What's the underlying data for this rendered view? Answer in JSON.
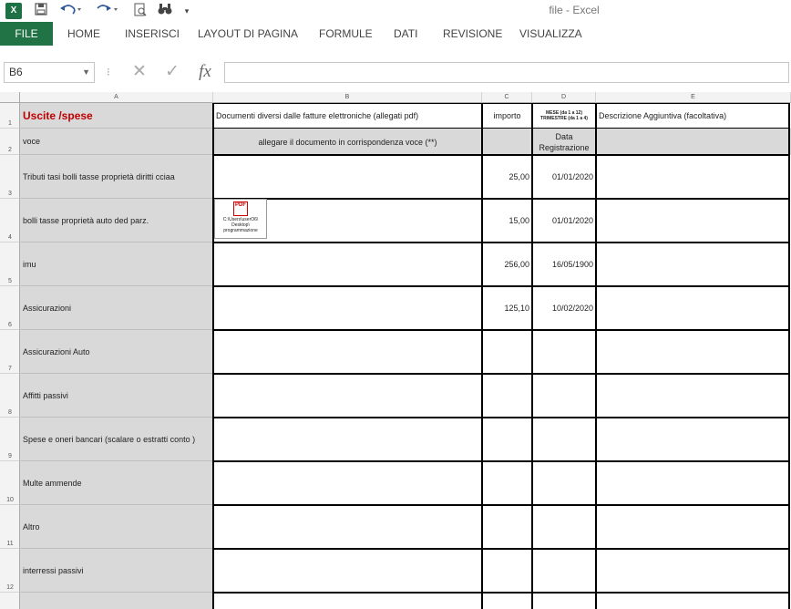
{
  "app": {
    "window_title": "file - Excel",
    "logo": "X",
    "qat": {
      "save_icon": "save-icon",
      "undo_icon": "undo-icon",
      "redo_icon": "redo-icon",
      "preview_icon": "print-preview-icon",
      "find_icon": "binoculars-icon"
    }
  },
  "ribbon": {
    "file_tab": "FILE",
    "tabs": [
      "HOME",
      "INSERISCI",
      "LAYOUT DI PAGINA",
      "FORMULE",
      "DATI",
      "REVISIONE",
      "VISUALIZZA"
    ]
  },
  "formula_bar": {
    "name_box": "B6",
    "cancel_glyph": "✕",
    "enter_glyph": "✓",
    "fx_glyph": "fx",
    "content": ""
  },
  "sheet": {
    "columns": [
      "A",
      "B",
      "C",
      "D",
      "E"
    ],
    "rows": [
      "1",
      "2",
      "3",
      "4",
      "5",
      "6",
      "7",
      "8",
      "9",
      "10",
      "11",
      "12"
    ],
    "header": {
      "a1": "Uscite /spese",
      "b1": "Documenti diversi dalle fatture elettroniche (allegati pdf)",
      "c1": "importo",
      "d1": "MESE (da 1 a 12) TRIMESTRE (da 1 a 4)",
      "e1": "Descrizione Aggiuntiva (facoltativa)",
      "a2": "voce",
      "b2": "allegare il documento in corrispondenza voce (**)",
      "d2": "Data Registrazione"
    },
    "items": [
      {
        "voce": "Tributi tasi bolli tasse proprietà diritti cciaa",
        "importo": "25,00",
        "data": "01/01/2020"
      },
      {
        "voce": "bolli tasse proprietà auto ded parz.",
        "importo": "15,00",
        "data": "01/01/2020"
      },
      {
        "voce": "imu",
        "importo": "256,00",
        "data": "16/05/1900"
      },
      {
        "voce": "Assicurazioni",
        "importo": "125,10",
        "data": "10/02/2020"
      },
      {
        "voce": "Assicurazioni Auto",
        "importo": "",
        "data": ""
      },
      {
        "voce": "Affitti passivi",
        "importo": "",
        "data": ""
      },
      {
        "voce": "Spese e oneri bancari (scalare o estratti conto )",
        "importo": "",
        "data": ""
      },
      {
        "voce": "Multe ammende",
        "importo": "",
        "data": ""
      },
      {
        "voce": "Altro",
        "importo": "",
        "data": ""
      },
      {
        "voce": "interressi passivi",
        "importo": "",
        "data": ""
      }
    ],
    "pdf_attachment": {
      "icon_label": "PDF",
      "path_text": "C:\\Users\\userO6\\ Desktop\\ programmazione"
    }
  }
}
